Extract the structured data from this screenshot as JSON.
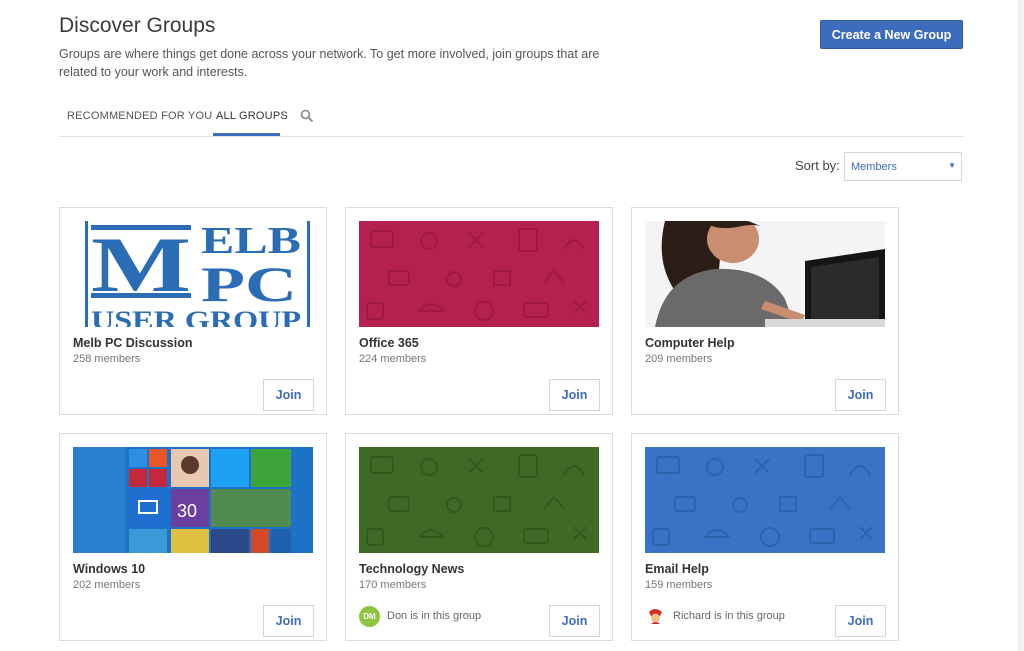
{
  "header": {
    "title": "Discover Groups",
    "description": "Groups are where things get done across your network. To get more involved, join groups that are related to your work and interests.",
    "create_button": "Create a New Group"
  },
  "tabs": [
    {
      "label": "RECOMMENDED FOR YOU",
      "active": false
    },
    {
      "label": "ALL GROUPS",
      "active": true
    }
  ],
  "search_icon": "search-icon",
  "sort": {
    "label": "Sort by:",
    "value": "Members"
  },
  "colors": {
    "accent": "#3d6cbd",
    "office365": "#b5214f",
    "technology_news": "#3f6a26",
    "email_help": "#3a73c6"
  },
  "groups": [
    {
      "name": "Melb PC Discussion",
      "members": "258 members",
      "image": "melb-pc-logo",
      "join": "Join"
    },
    {
      "name": "Office 365",
      "members": "224 members",
      "image": "pattern-magenta",
      "join": "Join"
    },
    {
      "name": "Computer Help",
      "members": "209 members",
      "image": "photo-woman-laptop",
      "join": "Join"
    },
    {
      "name": "Windows 10",
      "members": "202 members",
      "image": "windows-start-screen",
      "join": "Join"
    },
    {
      "name": "Technology News",
      "members": "170 members",
      "image": "pattern-green",
      "join": "Join",
      "member_note": {
        "initials": "DM",
        "text": "Don is in this group"
      }
    },
    {
      "name": "Email Help",
      "members": "159 members",
      "image": "pattern-blue",
      "join": "Join",
      "member_note": {
        "initials": "",
        "text": "Richard is in this group"
      }
    }
  ],
  "logo_text": {
    "line1": "MELB",
    "line2": "PC",
    "line3": "USER GROUP"
  },
  "windows_tile_date": "30"
}
